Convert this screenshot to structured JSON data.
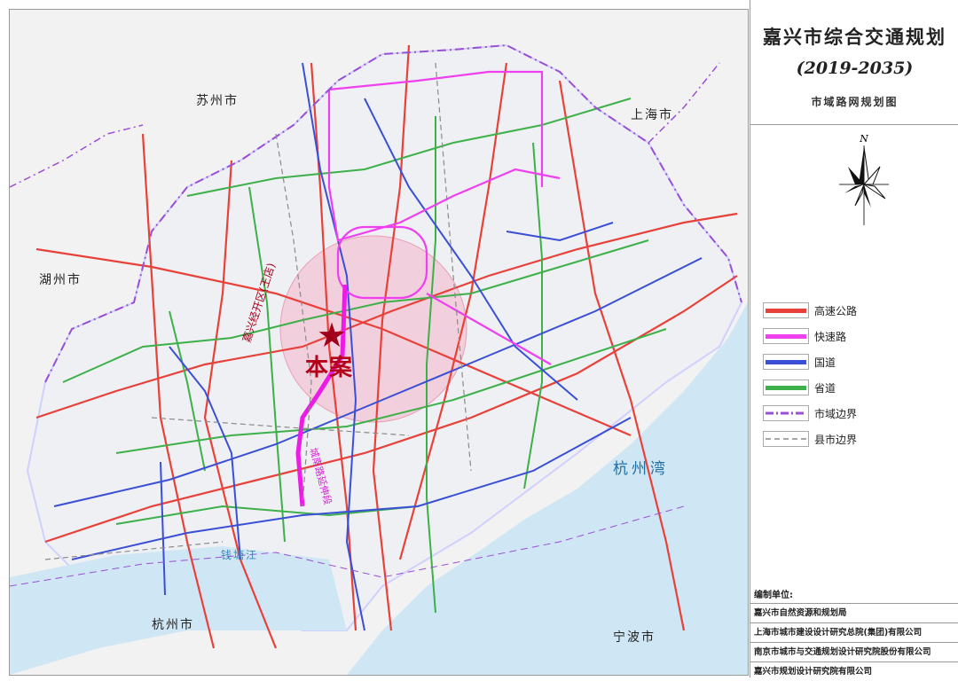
{
  "map": {
    "neighbors": {
      "suzhou": "苏州市",
      "shanghai": "上海市",
      "huzhou": "湖州市",
      "hangzhou": "杭州市",
      "ningbo": "宁波市"
    },
    "water": {
      "hangzhou_bay": "杭州湾",
      "qiantang_river": "钱塘江"
    },
    "project_label": "本案",
    "project_road": "嘉兴经开区(王店)",
    "extension_road": "城南路延伸段",
    "colors": {
      "expressway": "#e8413a",
      "express_road": "#ef3fef",
      "national_road": "#3b4fd6",
      "provincial_road": "#3eb04a",
      "city_boundary": "#9a4fd6",
      "county_boundary": "#8a8a8a",
      "water": "#cfe6f5",
      "land": "#eef0f3",
      "project_highlight": "#ec1ce6"
    }
  },
  "panel": {
    "title": "嘉兴市综合交通规划",
    "period": "(2019-2035)",
    "subtitle": "市域路网规划图",
    "compass_label": "N",
    "legend": [
      {
        "label": "高速公路",
        "style": "solid",
        "color": "#e8413a"
      },
      {
        "label": "快速路",
        "style": "solid",
        "color": "#ef3fef"
      },
      {
        "label": "国道",
        "style": "solid",
        "color": "#3b4fd6"
      },
      {
        "label": "省道",
        "style": "solid",
        "color": "#3eb04a"
      },
      {
        "label": "市域边界",
        "style": "dashdot",
        "color": "#9a4fd6"
      },
      {
        "label": "县市边界",
        "style": "dashed",
        "color": "#8a8a8a"
      }
    ],
    "credits_heading": "编制单位:",
    "credits": [
      "嘉兴市自然资源和规划局",
      "上海市城市建设设计研究总院(集团)有限公司",
      "南京市城市与交通规划设计研究院股份有限公司",
      "嘉兴市规划设计研究院有限公司"
    ]
  }
}
